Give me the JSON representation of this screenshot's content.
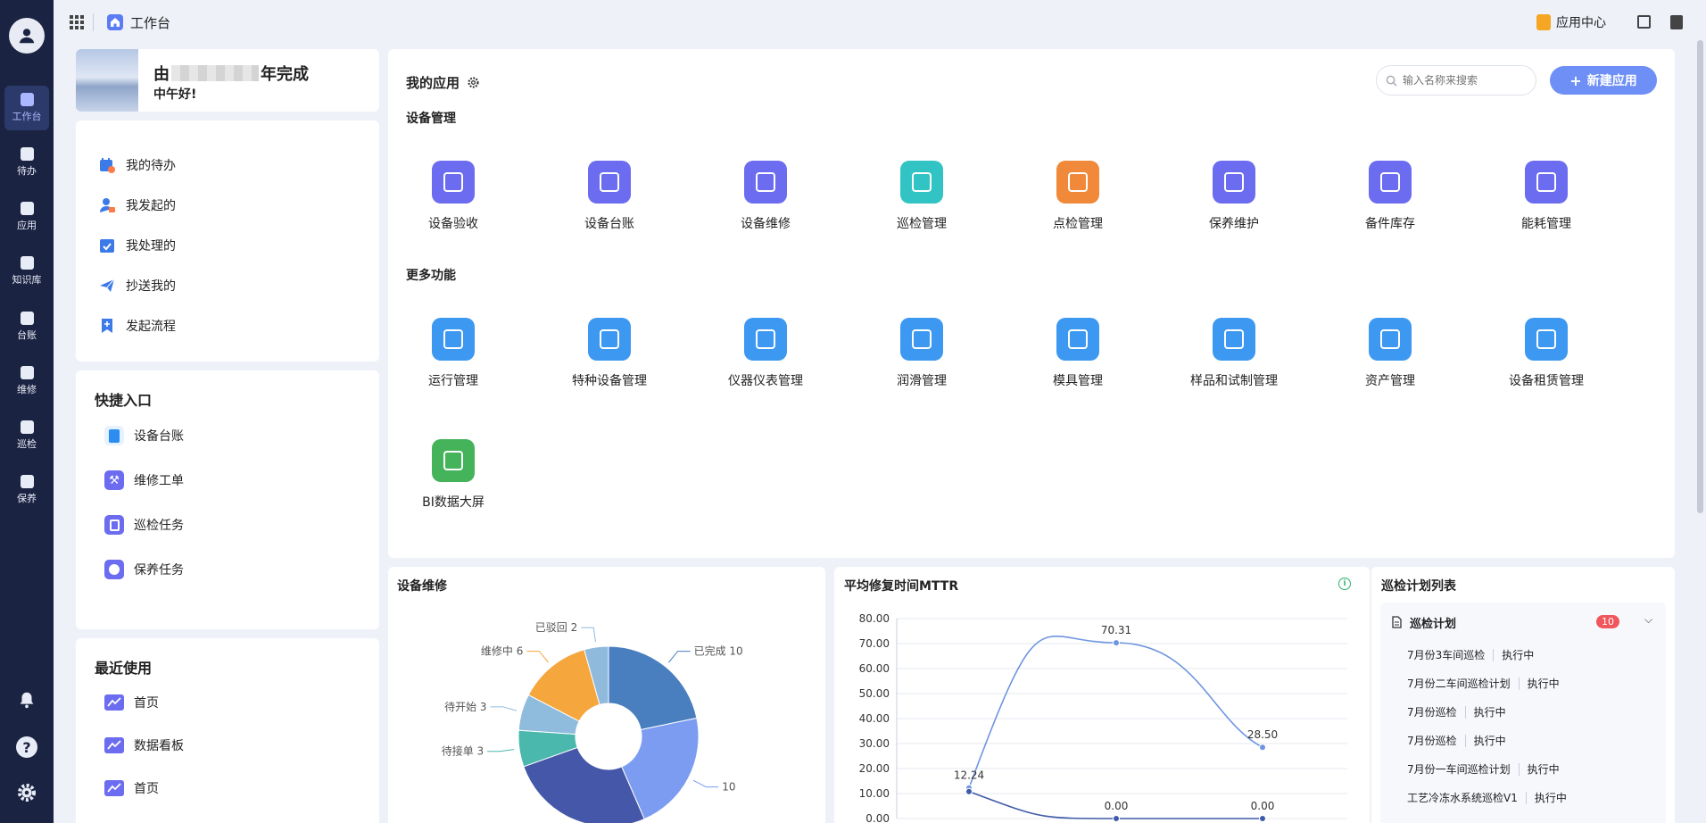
{
  "rail": {
    "items": [
      {
        "label": "工作台",
        "icon": "home-icon",
        "active": true
      },
      {
        "label": "待办",
        "icon": "clipboard-check-icon"
      },
      {
        "label": "应用",
        "icon": "apps-grid-icon"
      },
      {
        "label": "知识库",
        "icon": "knowledge-icon"
      },
      {
        "label": "台账",
        "icon": "ledger-icon"
      },
      {
        "label": "维修",
        "icon": "repair-icon"
      },
      {
        "label": "巡检",
        "icon": "inspection-icon"
      },
      {
        "label": "保养",
        "icon": "maintenance-icon"
      }
    ]
  },
  "topbar": {
    "title": "工作台",
    "app_center": "应用中心"
  },
  "welcome": {
    "title_prefix": "由",
    "title_suffix": "年完成",
    "greeting": "中午好!"
  },
  "workflow": {
    "items": [
      "我的待办",
      "我发起的",
      "我处理的",
      "抄送我的",
      "发起流程"
    ]
  },
  "quick": {
    "title": "快捷入口",
    "items": [
      "设备台账",
      "维修工单",
      "巡检任务",
      "保养任务"
    ]
  },
  "recent": {
    "title": "最近使用",
    "items": [
      "首页",
      "数据看板",
      "首页"
    ]
  },
  "my_apps": {
    "title": "我的应用",
    "search_placeholder": "输入名称来搜索",
    "new_button": "新建应用",
    "section1": "设备管理",
    "section1_apps": [
      "设备验收",
      "设备台账",
      "设备维修",
      "巡检管理",
      "点检管理",
      "保养维护",
      "备件库存",
      "能耗管理"
    ],
    "section2": "更多功能",
    "section2_apps": [
      "运行管理",
      "特种设备管理",
      "仪器仪表管理",
      "润滑管理",
      "模具管理",
      "样品和试制管理",
      "资产管理",
      "设备租赁管理",
      "BI数据大屏"
    ]
  },
  "repair_panel": {
    "title": "设备维修"
  },
  "mttr_panel": {
    "title": "平均修复时间MTTR"
  },
  "plan_panel": {
    "title": "巡检计划列表",
    "group": "巡检计划",
    "count": "10",
    "status": "执行中",
    "rows": [
      "7月份3车间巡检",
      "7月份二车间巡检计划",
      "7月份巡检",
      "7月份巡检",
      "7月份一车间巡检计划",
      "工艺冷冻水系统巡检V1"
    ]
  },
  "chart_data": [
    {
      "type": "pie",
      "title": "设备维修",
      "slices": [
        {
          "label": "已完成",
          "value": 10,
          "color": "#4a7fbf"
        },
        {
          "label": "",
          "value": 10,
          "color": "#7b9cf0"
        },
        {
          "label": "",
          "value": 12,
          "color": "#4557a8"
        },
        {
          "label": "待接单",
          "value": 3,
          "color": "#4ab8ac"
        },
        {
          "label": "待开始",
          "value": 3,
          "color": "#8fbcdd"
        },
        {
          "label": "维修中",
          "value": 6,
          "color": "#f5a63c"
        },
        {
          "label": "已驳回",
          "value": 2,
          "color": "#8fbadc"
        }
      ]
    },
    {
      "type": "line",
      "title": "平均修复时间MTTR",
      "ylim": [
        0,
        80
      ],
      "yticks": [
        "80.00",
        "70.00",
        "60.00",
        "50.00",
        "40.00",
        "30.00",
        "20.00",
        "10.00",
        "0.00"
      ],
      "series": [
        {
          "values": [
            12.24,
            70.31,
            28.5
          ],
          "labels": [
            "12.24",
            "70.31",
            "28.50"
          ],
          "color": "#6e95e0"
        },
        {
          "values": [
            10.8,
            0,
            0
          ],
          "labels": [
            "",
            "0.00",
            "0.00"
          ],
          "color": "#3e5aa8"
        }
      ]
    }
  ]
}
